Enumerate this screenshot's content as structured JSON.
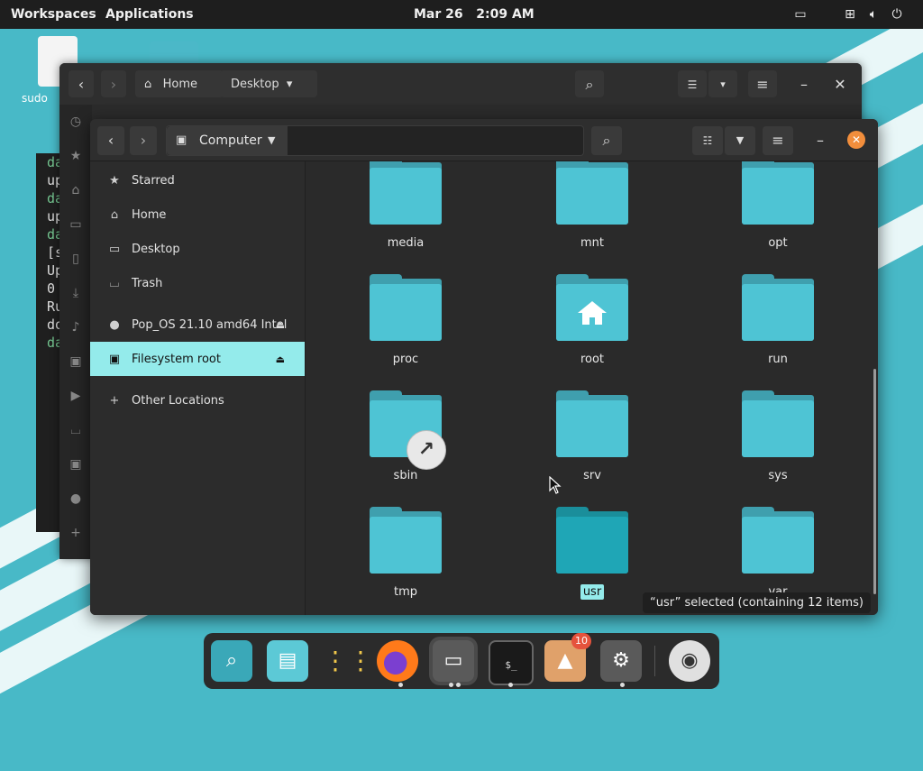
{
  "topbar": {
    "workspaces": "Workspaces",
    "applications": "Applications",
    "date": "Mar 26",
    "time": "2:09 AM",
    "tray_icons": [
      "display-icon",
      "network-icon",
      "volume-icon",
      "power-icon"
    ]
  },
  "desktop": {
    "doc_label": "sudo",
    "terminal_lines": [
      {
        "text": "da",
        "green": true
      },
      {
        "text": "up",
        "green": false
      },
      {
        "text": "da",
        "green": true
      },
      {
        "text": "up",
        "green": false
      },
      {
        "text": "da",
        "green": true
      },
      {
        "text": "[s",
        "green": false
      },
      {
        "text": "Up",
        "green": false
      },
      {
        "text": "0",
        "green": false
      },
      {
        "text": "Ru",
        "green": false
      },
      {
        "text": "do",
        "green": false
      },
      {
        "text": "da",
        "green": true
      }
    ]
  },
  "back_window": {
    "path_home": "Home",
    "path_desktop": "Desktop",
    "side_icons": [
      "recent-icon",
      "starred-icon",
      "home-icon",
      "desktop-icon",
      "documents-icon",
      "downloads-icon",
      "music-icon",
      "pictures-icon",
      "videos-icon",
      "trash-icon",
      "drive-icon",
      "disc-icon",
      "plus-icon"
    ]
  },
  "window": {
    "path_label": "Computer",
    "sidebar": [
      {
        "label": "Starred",
        "icon": "star-icon",
        "active": false
      },
      {
        "label": "Home",
        "icon": "home-icon",
        "active": false
      },
      {
        "label": "Desktop",
        "icon": "desktop-icon",
        "active": false
      },
      {
        "label": "Trash",
        "icon": "trash-icon",
        "active": false
      },
      {
        "label": "Pop_OS 21.10 amd64 Intel",
        "icon": "disc-icon",
        "active": false,
        "eject": true
      },
      {
        "label": "Filesystem root",
        "icon": "drive-icon",
        "active": true,
        "eject": true
      },
      {
        "label": "Other Locations",
        "icon": "plus-icon",
        "active": false
      }
    ],
    "files": [
      {
        "name": "media"
      },
      {
        "name": "mnt"
      },
      {
        "name": "opt"
      },
      {
        "name": "proc"
      },
      {
        "name": "root",
        "home": true
      },
      {
        "name": "run"
      },
      {
        "name": "sbin",
        "link": true
      },
      {
        "name": "srv"
      },
      {
        "name": "sys"
      },
      {
        "name": "tmp"
      },
      {
        "name": "usr",
        "selected": true
      },
      {
        "name": "var"
      }
    ],
    "status": "“usr” selected  (containing 12 items)"
  },
  "dock": {
    "items": [
      "search-app-icon",
      "files-layout-icon",
      "app-grid-icon",
      "firefox-icon",
      "files-icon",
      "terminal-icon",
      "pop-shop-icon",
      "settings-icon",
      "disc-drive-icon"
    ],
    "shop_badge": "10"
  },
  "colors": {
    "accent": "#94ebeb",
    "folder": "#4ec4d4",
    "desktop_bg": "#48b9c7",
    "close_button": "#f28e3c"
  }
}
